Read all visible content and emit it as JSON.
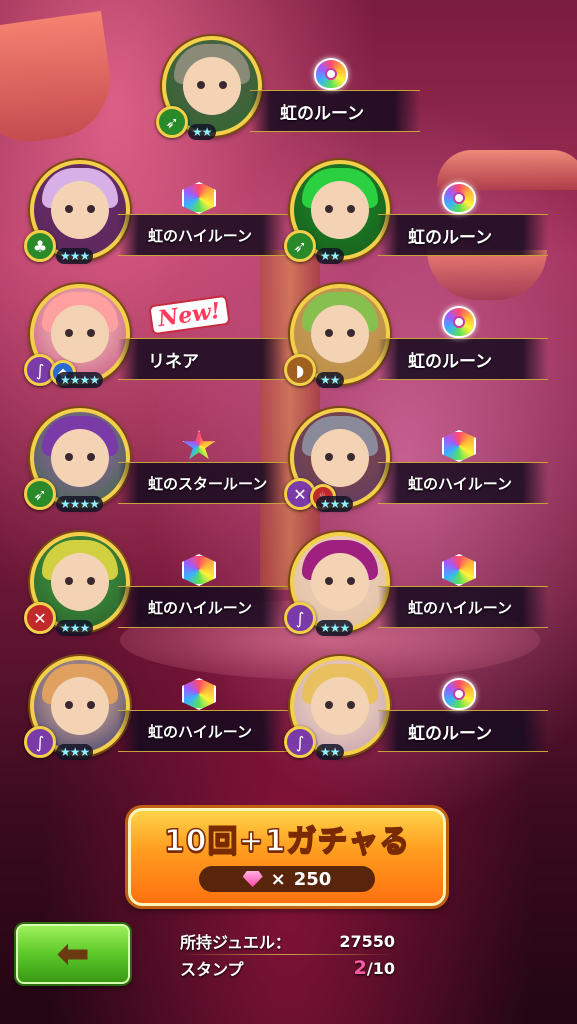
{
  "results": [
    {
      "id": "c1",
      "name": "虹のルーン",
      "stars": "★★",
      "element": "green",
      "weapon": "spear",
      "rune": "round",
      "portrait_hue": "#5a5a50",
      "hair": "#8a8a78",
      "frame_bg": "#2a6a2a"
    },
    {
      "id": "c2",
      "name": "虹のハイルーン",
      "stars": "★★★",
      "element": "green",
      "weapon": "tree",
      "rune": "hex",
      "portrait_hue": "#6a2a6a",
      "hair": "#d8b0e8",
      "frame_bg": "#5a2a5a"
    },
    {
      "id": "c3",
      "name": "虹のルーン",
      "stars": "★★",
      "element": "green",
      "weapon": "spear",
      "rune": "round",
      "portrait_hue": "#1a8a2a",
      "hair": "#2ad040",
      "frame_bg": "#1a5a1a"
    },
    {
      "id": "c4",
      "name": "リネア",
      "stars": "★★★★",
      "element": "purple",
      "weapon": "staff",
      "rune": "none",
      "is_new": true,
      "new_label": "New!",
      "portrait_hue": "#ffd0c0",
      "hair": "#ffa0a0",
      "frame_bg": "#c05080"
    },
    {
      "id": "c5",
      "name": "虹のルーン",
      "stars": "★★",
      "element": "brown",
      "weapon": "bow",
      "rune": "round",
      "portrait_hue": "#c0a060",
      "hair": "#88c050",
      "frame_bg": "#c08a40"
    },
    {
      "id": "c6",
      "name": "虹のスタールーン",
      "stars": "★★★★",
      "element": "green",
      "weapon": "spear",
      "rune": "star",
      "portrait_hue": "#a060c0",
      "hair": "#7a3aa8",
      "frame_bg": "#3a6a3a"
    },
    {
      "id": "c7",
      "name": "虹のハイルーン",
      "stars": "★★★",
      "element": "purple",
      "weapon": "sword",
      "rune": "hex",
      "portrait_hue": "#8a4a3a",
      "hair": "#8a8a9a",
      "frame_bg": "#5a3a6a"
    },
    {
      "id": "c8",
      "name": "虹のハイルーン",
      "stars": "★★★",
      "element": "red",
      "weapon": "sword",
      "rune": "hex",
      "portrait_hue": "#40a040",
      "hair": "#d0d040",
      "frame_bg": "#2a5a2a"
    },
    {
      "id": "c9",
      "name": "虹のハイルーン",
      "stars": "★★★",
      "element": "purple",
      "weapon": "staff",
      "rune": "hex",
      "portrait_hue": "#f0d0c0",
      "hair": "#a02080",
      "frame_bg": "#e0c0a0"
    },
    {
      "id": "c10",
      "name": "虹のハイルーン",
      "stars": "★★★",
      "element": "purple",
      "weapon": "staff",
      "rune": "hex",
      "portrait_hue": "#f0c0a0",
      "hair": "#e0a060",
      "frame_bg": "#3a3a6a"
    },
    {
      "id": "c11",
      "name": "虹のルーン",
      "stars": "★★",
      "element": "purple",
      "weapon": "staff",
      "rune": "round",
      "portrait_hue": "#ffe0c0",
      "hair": "#e8c060",
      "frame_bg": "#c0a0b0"
    }
  ],
  "gacha_button": {
    "title": "10回+1ガチャる",
    "cost_symbol": "×",
    "cost": "250"
  },
  "info": {
    "jewel_label": "所持ジュエル：",
    "jewel_value": "27550",
    "stamp_label": "スタンプ",
    "stamp_current": "2",
    "stamp_max": "/10"
  },
  "back_button": {
    "arrow": "⬅"
  },
  "colors": {
    "frame_gold": "#f4cf4a",
    "gacha_orange": "#ff8a20",
    "back_green": "#5cc82a",
    "stamp_pink": "#ff5aa8"
  }
}
